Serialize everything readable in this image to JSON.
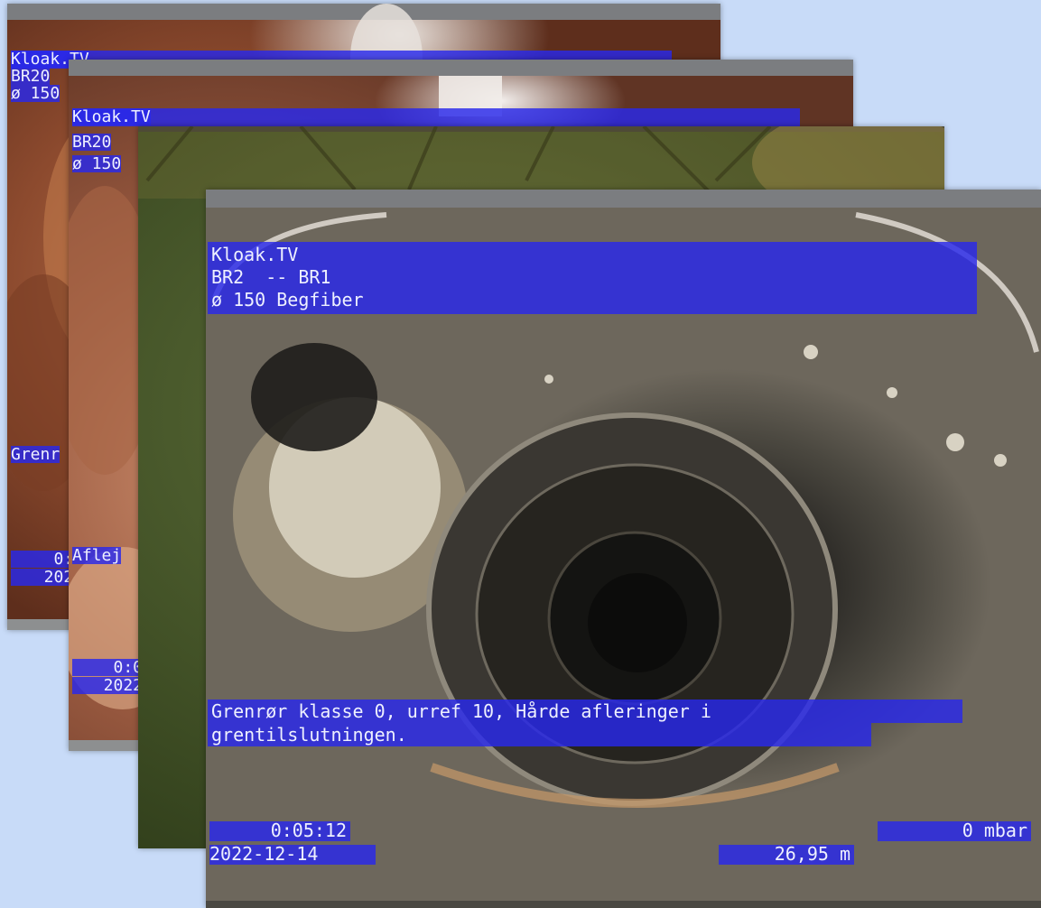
{
  "frames": [
    {
      "header": [
        "Kloak.TV",
        "BR20",
        "ø 150"
      ],
      "caption": [
        "Grenr"
      ],
      "time": "0:0",
      "date": "2022"
    },
    {
      "header": [
        "Kloak.TV",
        "BR20",
        "ø 150"
      ],
      "caption": [
        "Aflej"
      ],
      "time": "0:0",
      "date": "2022"
    },
    {},
    {
      "header": [
        "Kloak.TV",
        "BR2  -- BR1",
        "ø 150 Begfiber"
      ],
      "caption": [
        "Grenrør klasse 0, urref 10, Hårde afleringer i",
        "grentilslutningen."
      ],
      "time": "0:05:12",
      "date": "2022-12-14",
      "pressure": "0 mbar",
      "distance": "26,95 m"
    }
  ]
}
